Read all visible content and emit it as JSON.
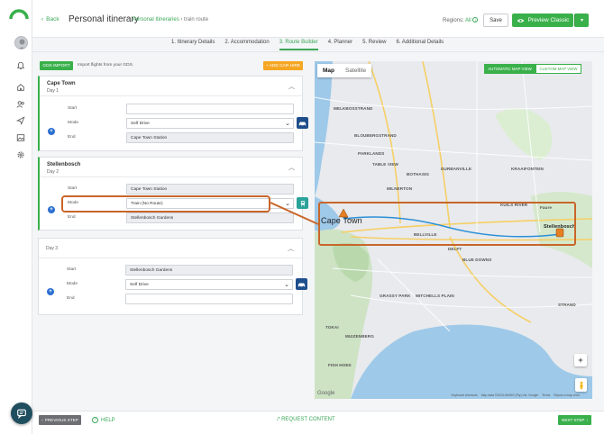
{
  "header": {
    "back_label": "Back",
    "title": "Personal itinerary",
    "breadcrumb_link": "Personal Itineraries",
    "breadcrumb_sep": "›",
    "breadcrumb_current": "train route",
    "regions_label": "Regions:",
    "regions_value": "All",
    "save_label": "Save",
    "preview_label": "Preview Classic"
  },
  "steps": [
    {
      "label": "1. Itinerary Details",
      "active": false
    },
    {
      "label": "2. Accommodation",
      "active": false
    },
    {
      "label": "3. Route Builder",
      "active": true
    },
    {
      "label": "4. Planner",
      "active": false
    },
    {
      "label": "5. Review",
      "active": false
    },
    {
      "label": "6. Additional Details",
      "active": false
    }
  ],
  "toolbar": {
    "gds_label": "GDS IMPORT",
    "gds_text": "Import flights from your GDS.",
    "add_car_label": "+ ADD CAR HIRE"
  },
  "legs": [
    {
      "title": "Cape Town",
      "day": "Day 1",
      "labels": {
        "start": "Start",
        "mode": "Mode",
        "end": "End"
      },
      "start": "",
      "mode": "Self Drive",
      "end": "Cape Town Station"
    },
    {
      "title": "Stellenbosch",
      "day": "Day 2",
      "labels": {
        "start": "Start",
        "mode": "Mode",
        "end": "End"
      },
      "start": "Cape Town Station",
      "mode": "Train (No Route)",
      "end": "Stellenbosch Gardens"
    },
    {
      "title": "",
      "day": "Day 3",
      "labels": {
        "start": "Start",
        "mode": "Mode",
        "end": "End"
      },
      "start": "Stellenbosch Gardens",
      "mode": "Self Drive",
      "end": ""
    }
  ],
  "map": {
    "tab_map": "Map",
    "tab_satellite": "Satellite",
    "auto_view": "AUTOMATIC MAP VIEW",
    "custom_view": "CUSTOM MAP VIEW",
    "labels": {
      "melkbosstrand": "MELKBOSSTRAND",
      "parklands": "PARKLANDS",
      "blouberg": "BLOUBERGSTRAND",
      "table_view": "TABLE VIEW",
      "durbanville": "DURBANVILLE",
      "bothasig": "BOTHASIG",
      "kraaifontein": "KRAAIFONTEIN",
      "milnerton": "MILNERTON",
      "kuils": "KUILS RIVER",
      "cape_town": "Cape Town",
      "bellville": "BELLVILLE",
      "stellenbosch": "Stellenbosch",
      "delft": "DELFT",
      "blue_downs": "BLUE DOWNS",
      "grassy_park": "GRASSY PARK",
      "mitchells": "MITCHELLS PLAIN",
      "tokai": "TOKAI",
      "fish_hoek": "FISH HOEK",
      "faure": "Faure",
      "strand": "STRAND",
      "muizenberg": "MUIZENBERG"
    },
    "footer_keyboard": "Keyboard shortcuts",
    "footer_data": "Map data ©2024 AfriGIS (Pty) Ltd, Google",
    "footer_terms": "Terms",
    "footer_report": "Report a map error",
    "google": "Google"
  },
  "footer": {
    "prev_label": "PREVIOUS STEP",
    "help_label": "HELP",
    "request_label": "REQUEST CONTENT",
    "next_label": "NEXT STEP"
  },
  "colors": {
    "accent": "#3ab04b",
    "highlight": "#c8662a",
    "primary_blue": "#1f4e8c",
    "teal": "#2aa39a",
    "add_car": "#f5a623"
  }
}
